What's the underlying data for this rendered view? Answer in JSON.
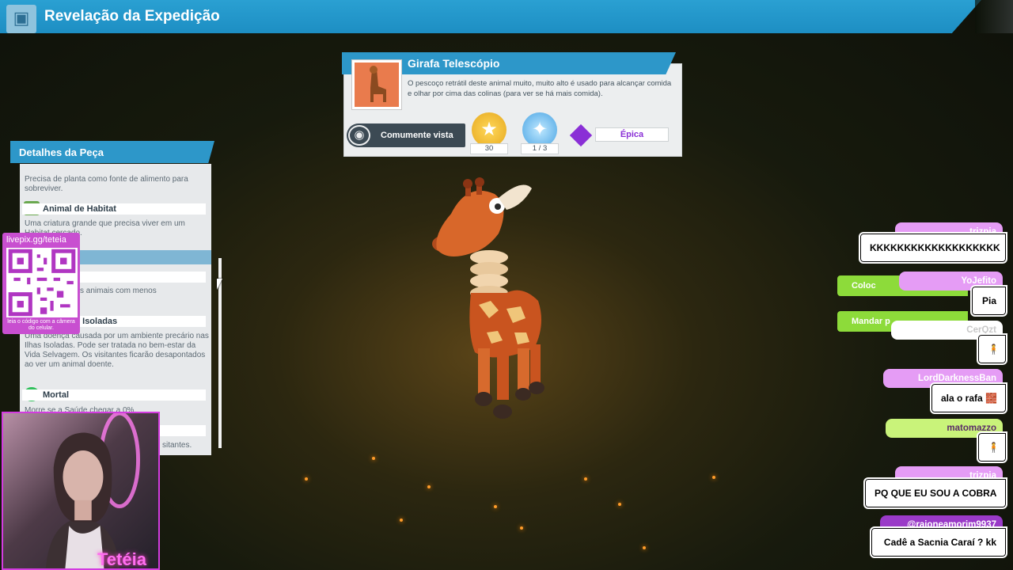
{
  "header": {
    "title": "Revelação da Expedição",
    "icon": "expedition-box-icon"
  },
  "animal": {
    "name": "Girafa Telescópio",
    "description": "O pescoço retrátil deste animal muito, muito alto é usado para alcançar comida e olhar por cima das colinas (para ver se há mais comida).",
    "sighting": "Comumente vista",
    "stars": "30",
    "research": "1 / 3",
    "rarity": "Épica",
    "rarity_color": "#8a2fd6"
  },
  "details": {
    "title": "Detalhes da Peça",
    "plant_text": "Precisa de planta como fonte de alimento para sobreviver.",
    "habitat_label": "Animal de Habitat",
    "habitat_text": "Uma criatura grande que precisa viver em um Habitat cercado.",
    "sub_header_partial": "as",
    "partial_trait": "r",
    "partial_text": "s animais com menos",
    "disease_label": "das Ilhas Isoladas",
    "disease_text": "Uma doença causada por um ambiente precário nas Ilhas Isoladas. Pode ser tratada no bem-estar da Vida Selvagem. Os visitantes ficarão desapontados ao ver um animal doente.",
    "mortal_label": "Mortal",
    "mortal_text": "Morre se a Saúde chegar a 0%.",
    "bottom_text": "sitantes."
  },
  "overlay": {
    "livepix_url": "livepix.gg/teteia",
    "qr_caption": "leia o código com a câmera do celular.",
    "streamer_name": "Tetéia"
  },
  "buttons": {
    "place": "Coloc",
    "send": "Mandar p"
  },
  "chat": [
    {
      "user": "trizpia",
      "message": "KKKKKKKKKKKKKKKKKKK"
    },
    {
      "user": "YoJefito",
      "message": "Pia"
    },
    {
      "user": "CerQzt",
      "message": "🧍"
    },
    {
      "user": "LordDarknessBan",
      "message": "ala o rafa 🧱"
    },
    {
      "user": "matomazzo",
      "message": "🧍"
    },
    {
      "user": "trizpia",
      "message": "PQ QUE EU SOU A COBRA"
    },
    {
      "user": "@raioneamorim9937",
      "message": "Cadê a Sacnia Caraí ? kk"
    }
  ]
}
